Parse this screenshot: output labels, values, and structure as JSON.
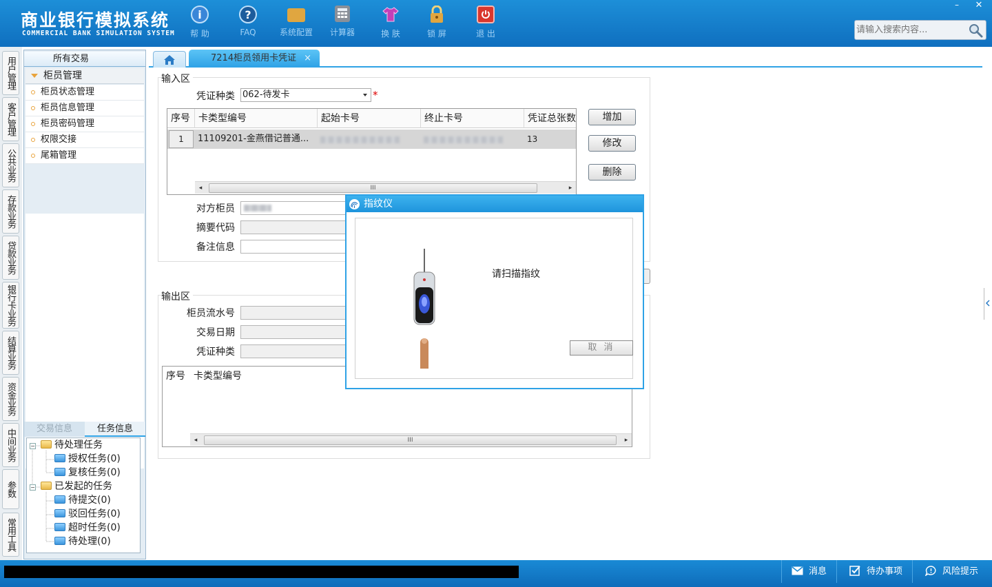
{
  "app": {
    "title_cn": "商业银行模拟系统",
    "title_en": "COMMERCIAL BANK SIMULATION SYSTEM"
  },
  "toolbar": [
    {
      "label": "帮 助",
      "icon": "info-icon",
      "color": "#3a86d8"
    },
    {
      "label": "FAQ",
      "icon": "question-icon",
      "color": "#1d5c9c"
    },
    {
      "label": "系统配置",
      "icon": "toolbox-icon",
      "color": "#e0a640"
    },
    {
      "label": "计算器",
      "icon": "calculator-icon",
      "color": "#8a9099"
    },
    {
      "label": "换 肤",
      "icon": "tshirt-icon",
      "color": "#c33fb8"
    },
    {
      "label": "锁 屏",
      "icon": "lock-icon",
      "color": "#e0a640"
    },
    {
      "label": "退 出",
      "icon": "power-icon",
      "color": "#d9372d"
    }
  ],
  "window": {
    "minimize": "–",
    "close": "✕"
  },
  "search": {
    "placeholder": "请输入搜索内容..."
  },
  "vertical_tabs": [
    "用户管理",
    "客户管理",
    "公共业务",
    "存款业务",
    "贷款业务",
    "银行卡业务",
    "结算业务",
    "资金业务",
    "中间业务",
    "参数",
    "常用工具"
  ],
  "left_panel": {
    "header": "所有交易",
    "group": "柜员管理",
    "items": [
      "柜员状态管理",
      "柜员信息管理",
      "柜员密码管理",
      "权限交接",
      "尾箱管理"
    ],
    "tabs": [
      "交易信息",
      "任务信息"
    ],
    "tree": {
      "pending": {
        "label": "待处理任务",
        "children": [
          "授权任务(0)",
          "复核任务(0)"
        ]
      },
      "initiated": {
        "label": "已发起的任务",
        "children": [
          "待提交(0)",
          "驳回任务(0)",
          "超时任务(0)",
          "待处理(0)"
        ]
      }
    }
  },
  "tabs": {
    "active": "7214柜员领用卡凭证",
    "close": "×"
  },
  "input_area": {
    "title": "输入区",
    "voucher_type_label": "凭证种类",
    "voucher_type_value": "062-待发卡",
    "required": "*",
    "grid": {
      "columns": [
        "序号",
        "卡类型编号",
        "起始卡号",
        "终止卡号",
        "凭证总张数"
      ],
      "rows": [
        {
          "no": "1",
          "card_type": "11109201-金燕借记普通...",
          "total": "13"
        }
      ]
    },
    "scroll_thumb": "III",
    "buttons": {
      "add": "增加",
      "modify": "修改",
      "delete": "删除"
    },
    "labels": {
      "counterpart_teller": "对方柜员",
      "summary_code": "摘要代码",
      "remark": "备注信息"
    }
  },
  "output_area": {
    "title": "输出区",
    "labels": {
      "serial": "柜员流水号",
      "trans_date": "交易日期",
      "voucher_type": "凭证种类"
    },
    "grid": {
      "columns": [
        "序号",
        "卡类型编号"
      ]
    },
    "scroll_thumb": "III"
  },
  "dialog": {
    "title": "指纹仪",
    "message": "请扫描指纹",
    "cancel": "取 消"
  },
  "footer": {
    "messages": "消息",
    "todo": "待办事项",
    "risk": "风险提示"
  }
}
